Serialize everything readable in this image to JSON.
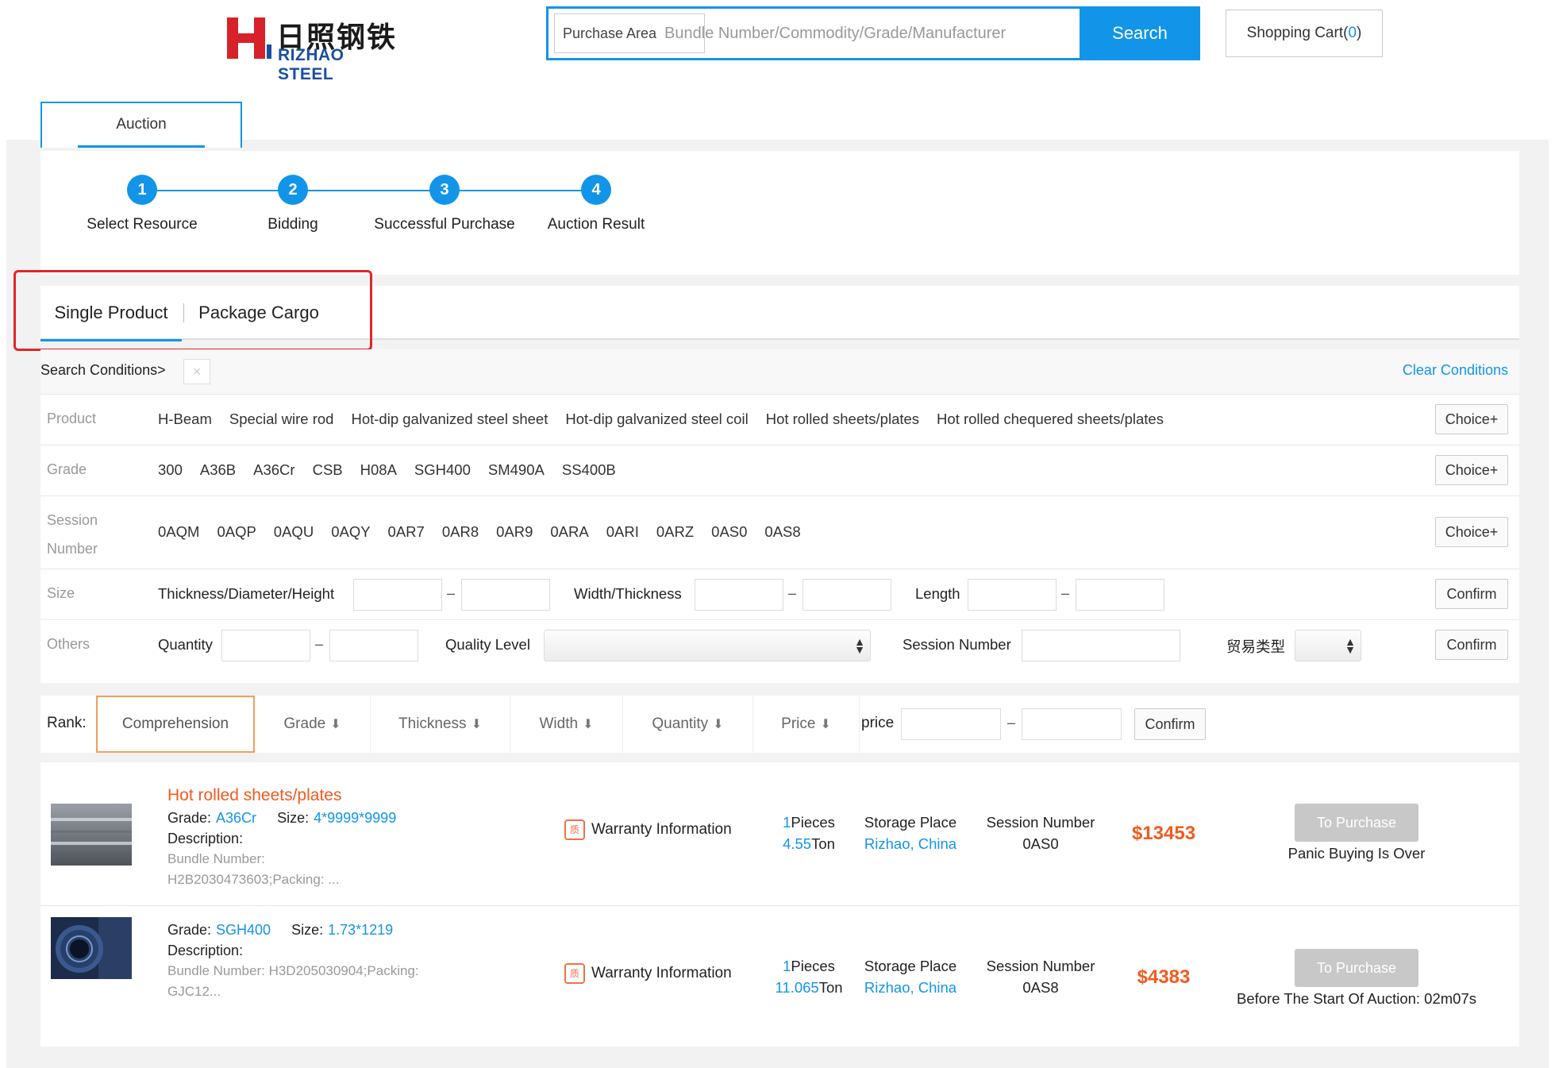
{
  "header": {
    "logo_cn": "日照钢铁",
    "logo_en": "RIZHAO STEEL",
    "purchase_area": "Purchase Area",
    "search_placeholder": "Bundle Number/Commodity/Grade/Manufacturer",
    "search_label": "Search",
    "cart_label": "Shopping Cart(",
    "cart_count": "0",
    "cart_close": ")"
  },
  "colors": {
    "accent": "#1295e8",
    "price": "#f35a1e",
    "highlight": "#e0262b"
  },
  "top_tab": "Auction",
  "steps": [
    {
      "num": "1",
      "label": "Select Resource"
    },
    {
      "num": "2",
      "label": "Bidding"
    },
    {
      "num": "3",
      "label": "Successful Purchase"
    },
    {
      "num": "4",
      "label": "Auction Result"
    }
  ],
  "type_tabs": {
    "single": "Single Product",
    "package": "Package Cargo"
  },
  "conditions": {
    "label": "Search Conditions>",
    "clear_x": "×",
    "clear": "Clear Conditions"
  },
  "filters": {
    "product": {
      "label": "Product",
      "options": [
        "H-Beam",
        "Special wire rod",
        "Hot-dip galvanized steel sheet",
        "Hot-dip galvanized steel coil",
        "Hot rolled sheets/plates",
        "Hot rolled chequered sheets/plates"
      ],
      "button": "Choice+"
    },
    "grade": {
      "label": "Grade",
      "options": [
        "300",
        "A36B",
        "A36Cr",
        "CSB",
        "H08A",
        "SGH400",
        "SM490A",
        "SS400B"
      ],
      "button": "Choice+"
    },
    "session": {
      "label_1": "Session",
      "label_2": "Number",
      "options": [
        "0AQM",
        "0AQP",
        "0AQU",
        "0AQY",
        "0AR7",
        "0AR8",
        "0AR9",
        "0ARA",
        "0ARI",
        "0ARZ",
        "0AS0",
        "0AS8"
      ],
      "button": "Choice+"
    },
    "size": {
      "label": "Size",
      "thickness": "Thickness/Diameter/Height",
      "width": "Width/Thickness",
      "length": "Length",
      "dash": "–",
      "button": "Confirm"
    },
    "others": {
      "label": "Others",
      "quantity": "Quantity",
      "quality": "Quality Level",
      "session": "Session Number",
      "trade_type": "贸易类型",
      "dash": "–",
      "button": "Confirm"
    }
  },
  "rank": {
    "label": "Rank:",
    "items": [
      "Comprehension",
      "Grade",
      "Thickness",
      "Width",
      "Quantity",
      "Price"
    ],
    "price_label": "price",
    "dash": "–",
    "button": "Confirm"
  },
  "products": [
    {
      "title": "Hot rolled sheets/plates",
      "grade_label": "Grade:",
      "grade": "A36Cr",
      "size_label": "Size:",
      "size": "4*9999*9999",
      "desc_label": "Description:",
      "bundle_label": "Bundle Number:",
      "bundle": "H2B2030473603;Packing: ...",
      "warranty": "Warranty Information",
      "warranty_icon": "质",
      "pieces": "1",
      "pieces_unit": "Pieces",
      "tons": "4.55",
      "tons_unit": "Ton",
      "storage_label": "Storage Place",
      "storage": "Rizhao, China",
      "session_label": "Session Number",
      "session": "0AS0",
      "price": "$13453",
      "button": "To Purchase",
      "status": "Panic Buying Is Over"
    },
    {
      "title": "",
      "grade_label": "Grade:",
      "grade": "SGH400",
      "size_label": "Size:",
      "size": "1.73*1219",
      "desc_label": "Description:",
      "bundle_label": "Bundle Number:",
      "bundle": "H3D205030904;Packing:",
      "bundle_2": "GJC12...",
      "warranty": "Warranty Information",
      "warranty_icon": "质",
      "pieces": "1",
      "pieces_unit": "Pieces",
      "tons": "11.065",
      "tons_unit": "Ton",
      "storage_label": "Storage Place",
      "storage": "Rizhao, China",
      "session_label": "Session Number",
      "session": "0AS8",
      "price": "$4383",
      "button": "To Purchase",
      "status": "Before The Start Of Auction: 02m07s"
    }
  ]
}
